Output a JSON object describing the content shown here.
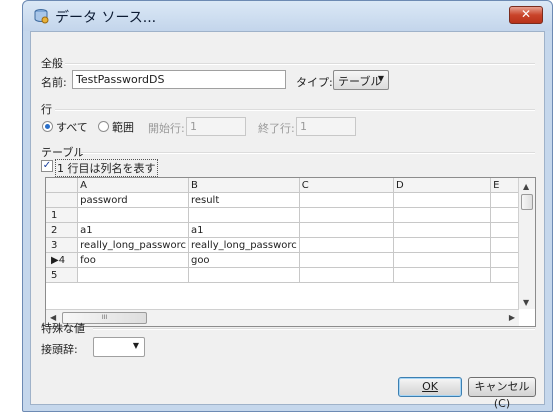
{
  "window": {
    "title": "データ ソース...",
    "close_glyph": "✕"
  },
  "general": {
    "header": "全般",
    "name_label": "名前:",
    "name_value": "TestPasswordDS",
    "type_label": "タイプ:",
    "type_value": "テーブル"
  },
  "rows": {
    "header": "行",
    "all_label": "すべて",
    "range_label": "範囲",
    "all_selected": true,
    "start_label": "開始行:",
    "start_value": "1",
    "end_label": "終了行:",
    "end_value": "1"
  },
  "table": {
    "header": "テーブル",
    "first_row_names_label": "1 行目は列名を表す",
    "first_row_names_checked": true,
    "columns": [
      "A",
      "B",
      "C",
      "D",
      "E"
    ],
    "rows": [
      {
        "marker": "",
        "cells": [
          "password",
          "result",
          "",
          "",
          ""
        ]
      },
      {
        "marker": "1",
        "cells": [
          "",
          "",
          "",
          "",
          ""
        ]
      },
      {
        "marker": "2",
        "cells": [
          "a1",
          "a1",
          "",
          "",
          ""
        ]
      },
      {
        "marker": "3",
        "cells": [
          "really_long_passworc",
          "really_long_passworc",
          "",
          "",
          ""
        ]
      },
      {
        "marker": "▶4",
        "cells": [
          "foo",
          "goo",
          "",
          "",
          ""
        ]
      },
      {
        "marker": "5",
        "cells": [
          "",
          "",
          "",
          "",
          ""
        ]
      }
    ],
    "hscroll_grip": "III"
  },
  "special": {
    "header": "特殊な値",
    "prefix_label": "接頭辞:",
    "prefix_value": ""
  },
  "buttons": {
    "ok": "OK",
    "cancel": "キャンセル(C)"
  }
}
